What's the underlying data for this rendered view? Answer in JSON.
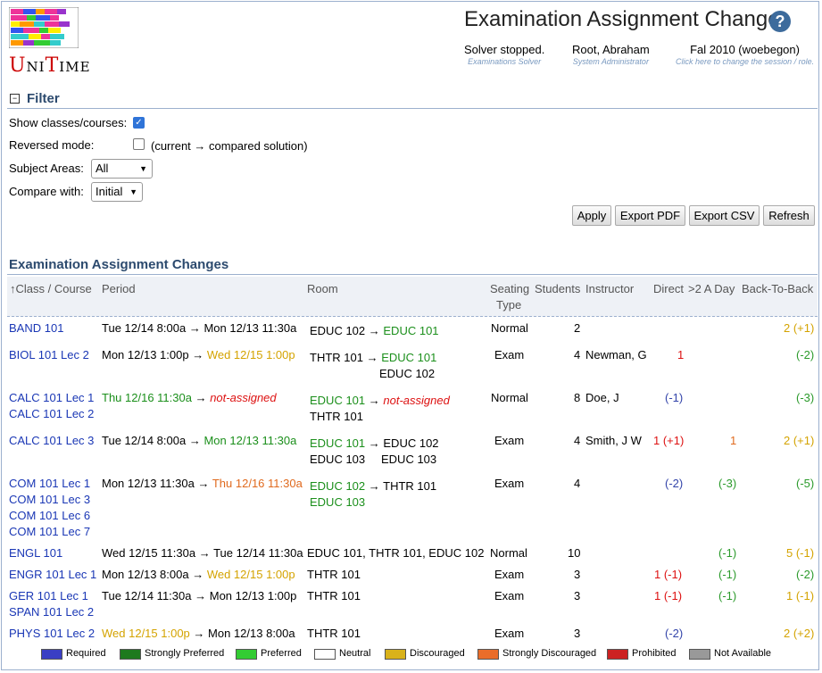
{
  "app": {
    "logo_text_u": "U",
    "logo_text_ni": "NI",
    "logo_text_t": "T",
    "logo_text_ime": "IME",
    "title": "Examination Assignment Changes",
    "help": "?"
  },
  "header": {
    "solver_status": "Solver stopped.",
    "solver_sub": "Examinations Solver",
    "user": "Root, Abraham",
    "user_sub": "System Administrator",
    "session": "Fal 2010 (woebegon)",
    "session_sub": "Click here to change the session / role."
  },
  "filter": {
    "title": "Filter",
    "collapse": "−",
    "show_classes_label": "Show classes/courses:",
    "show_classes_checked": true,
    "reversed_label": "Reversed mode:",
    "reversed_checked": false,
    "reversed_note": "(current → compared solution)",
    "subject_label": "Subject Areas:",
    "subject_value": "All",
    "compare_label": "Compare with:",
    "compare_value": "Initial",
    "buttons": [
      "Apply",
      "Export PDF",
      "Export CSV",
      "Refresh"
    ]
  },
  "table": {
    "title": "Examination Assignment Changes",
    "headers": {
      "class": "↑Class / Course",
      "period": "Period",
      "room": "Room",
      "seating1": "Seating",
      "seating2": "Type",
      "students": "Students",
      "instructor": "Instructor",
      "direct": "Direct",
      "twoday": ">2 A Day",
      "btb": "Back-To-Back"
    },
    "rows": [
      {
        "classes": [
          "BAND 101"
        ],
        "p_from": "Tue 12/14 8:00a",
        "p_to": "Mon 12/13 11:30a",
        "r_from": "EDUC 102",
        "r_to": "EDUC 101",
        "seating": "Normal",
        "students": "2",
        "instructor": "",
        "direct": "",
        "twoday": "",
        "btb": "2 (+1)"
      },
      {
        "classes": [
          "BIOL 101 Lec 2"
        ],
        "p_from": "Mon 12/13 1:00p",
        "p_to": "Wed 12/15 1:00p",
        "r_from": "THTR 101",
        "r_to": "EDUC 101",
        "r_extra": "EDUC 102",
        "seating": "Exam",
        "students": "4",
        "instructor": "Newman, G",
        "direct": "1",
        "twoday": "",
        "btb": "(-2)"
      },
      {
        "classes": [
          "CALC 101 Lec 1",
          "CALC 101 Lec 2"
        ],
        "p_from": "Thu 12/16 11:30a",
        "p_to": "not-assigned",
        "r_from": "EDUC 101",
        "r_to": "not-assigned",
        "r_extra": "THTR 101",
        "seating": "Normal",
        "students": "8",
        "instructor": "Doe, J",
        "direct": "(-1)",
        "twoday": "",
        "btb": "(-3)"
      },
      {
        "classes": [
          "CALC 101 Lec 3"
        ],
        "p_from": "Tue 12/14 8:00a",
        "p_to": "Mon 12/13 11:30a",
        "r_from": "EDUC 101",
        "r_to": "EDUC 102",
        "r_extra": "EDUC 103",
        "r_extra2": "EDUC 103",
        "seating": "Exam",
        "students": "4",
        "instructor": "Smith, J W",
        "direct": "1 (+1)",
        "twoday": "1",
        "btb": "2 (+1)"
      },
      {
        "classes": [
          "COM 101 Lec 1",
          "COM 101 Lec 3",
          "COM 101 Lec 6",
          "COM 101 Lec 7"
        ],
        "p_from": "Mon 12/13 11:30a",
        "p_to": "Thu 12/16 11:30a",
        "r_from": "EDUC 102",
        "r_to": "THTR 101",
        "r_extra": "EDUC 103",
        "seating": "Exam",
        "students": "4",
        "instructor": "",
        "direct": "(-2)",
        "twoday": "(-3)",
        "btb": "(-5)"
      },
      {
        "classes": [
          "ENGL 101"
        ],
        "p_from": "Wed 12/15 11:30a",
        "p_to": "Tue 12/14 11:30a",
        "r_from": "EDUC 101, THTR 101, EDUC 102",
        "r_to": "",
        "seating": "Normal",
        "students": "10",
        "instructor": "",
        "direct": "",
        "twoday": "(-1)",
        "btb": "5 (-1)"
      },
      {
        "classes": [
          "ENGR 101 Lec 1"
        ],
        "p_from": "Mon 12/13 8:00a",
        "p_to": "Wed 12/15 1:00p",
        "r_from": "THTR 101",
        "r_to": "",
        "seating": "Exam",
        "students": "3",
        "instructor": "",
        "direct": "1 (-1)",
        "twoday": "(-1)",
        "btb": "(-2)"
      },
      {
        "classes": [
          "GER 101 Lec 1",
          "SPAN 101 Lec 2"
        ],
        "p_from": "Tue 12/14 11:30a",
        "p_to": "Mon 12/13 1:00p",
        "r_from": "THTR 101",
        "r_to": "",
        "seating": "Exam",
        "students": "3",
        "instructor": "",
        "direct": "1 (-1)",
        "twoday": "(-1)",
        "btb": "1 (-1)"
      },
      {
        "classes": [
          "PHYS 101 Lec 2"
        ],
        "p_from": "Wed 12/15 1:00p",
        "p_to": "Mon 12/13 8:00a",
        "r_from": "THTR 101",
        "r_to": "",
        "seating": "Exam",
        "students": "3",
        "instructor": "",
        "direct": "(-2)",
        "twoday": "",
        "btb": "2 (+2)"
      }
    ],
    "arrow": "→"
  },
  "legend": [
    {
      "label": "Required",
      "color": "#3a3fc4"
    },
    {
      "label": "Strongly Preferred",
      "color": "#1e7a1e"
    },
    {
      "label": "Preferred",
      "color": "#33cc33"
    },
    {
      "label": "Neutral",
      "color": "#ffffff"
    },
    {
      "label": "Discouraged",
      "color": "#d9b21a"
    },
    {
      "label": "Strongly Discouraged",
      "color": "#ea6d2a"
    },
    {
      "label": "Prohibited",
      "color": "#cc2222"
    },
    {
      "label": "Not Available",
      "color": "#999999"
    }
  ]
}
